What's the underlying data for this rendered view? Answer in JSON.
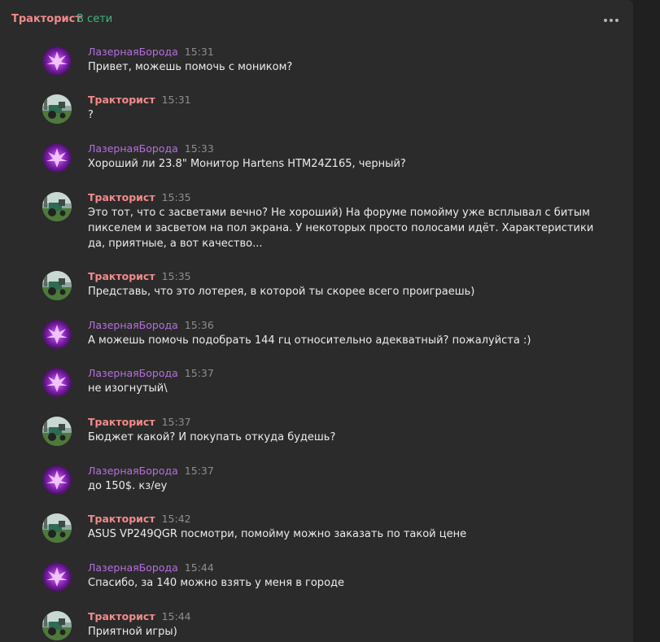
{
  "header": {
    "contact_name": "Тракторист",
    "status": "В сети"
  },
  "colors": {
    "traktorist_name": "#f28b8b",
    "laser_name": "#b66fe0",
    "online": "#43b581",
    "background": "#2b2b2b"
  },
  "messages": [
    {
      "author": "ЛазернаяБорода",
      "time": "15:31",
      "text": "Привет, можешь помочь с моником?"
    },
    {
      "author": "Тракторист",
      "time": "15:31",
      "text": "?"
    },
    {
      "author": "ЛазернаяБорода",
      "time": "15:33",
      "text": "Хороший ли 23.8\" Монитор Hartens HTM24Z165, черный?"
    },
    {
      "author": "Тракторист",
      "time": "15:35",
      "text": "Это тот, что с засветами вечно? Не хороший) На форуме помойму уже всплывал с битым пикселем и засветом на пол экрана. У некоторых просто полосами идёт. Характеристики да, приятные, а вот качество..."
    },
    {
      "author": "Тракторист",
      "time": "15:35",
      "text": "Представь, что это лотерея, в которой ты скорее всего проиграешь)"
    },
    {
      "author": "ЛазернаяБорода",
      "time": "15:36",
      "text": "А можешь помочь подобрать 144 гц относительно адекватный? пожалуйста :)"
    },
    {
      "author": "ЛазернаяБорода",
      "time": "15:37",
      "text": "не изогнутый\\"
    },
    {
      "author": "Тракторист",
      "time": "15:37",
      "text": "Бюджет какой? И покупать откуда будешь?"
    },
    {
      "author": "ЛазернаяБорода",
      "time": "15:37",
      "text": "до 150$. кз/еу"
    },
    {
      "author": "Тракторист",
      "time": "15:42",
      "text": "ASUS VP249QGR посмотри, помойму можно заказать по такой цене"
    },
    {
      "author": "ЛазернаяБорода",
      "time": "15:44",
      "text": "Спасибо, за 140 можно взять у меня в городе"
    },
    {
      "author": "Тракторист",
      "time": "15:44",
      "text": "Приятной игры)"
    }
  ]
}
